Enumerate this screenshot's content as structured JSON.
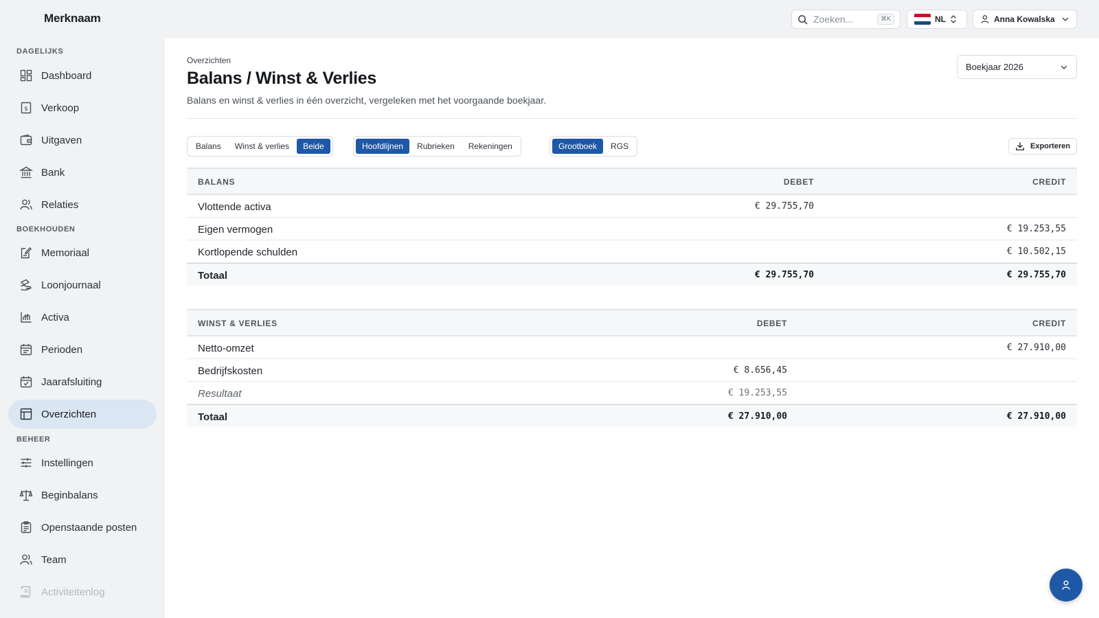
{
  "topbar": {
    "brand": "Merknaam",
    "search_placeholder": "Zoeken...",
    "search_shortcut": "⌘K",
    "language": "NL",
    "user_name": "Anna Kowalska"
  },
  "sidebar": {
    "sections": [
      "DAGELIJKS",
      "BOEKHOUDEN",
      "BEHEER"
    ],
    "items": [
      {
        "label": "Dashboard",
        "icon": "dashboard-icon"
      },
      {
        "label": "Verkoop",
        "icon": "invoice-icon"
      },
      {
        "label": "Uitgaven",
        "icon": "wallet-icon"
      },
      {
        "label": "Bank",
        "icon": "bank-icon"
      },
      {
        "label": "Relaties",
        "icon": "users-icon"
      },
      {
        "label": "Memoriaal",
        "icon": "edit-note-icon"
      },
      {
        "label": "Loonjournaal",
        "icon": "payroll-icon"
      },
      {
        "label": "Activa",
        "icon": "chart-icon"
      },
      {
        "label": "Perioden",
        "icon": "calendar-icon"
      },
      {
        "label": "Jaarafsluiting",
        "icon": "calendar-check-icon"
      },
      {
        "label": "Overzichten",
        "icon": "table-icon",
        "active": true
      },
      {
        "label": "Instellingen",
        "icon": "sliders-icon"
      },
      {
        "label": "Beginbalans",
        "icon": "scale-icon"
      },
      {
        "label": "Openstaande posten",
        "icon": "clipboard-icon"
      },
      {
        "label": "Team",
        "icon": "team-icon"
      },
      {
        "label": "Activiteitenlog",
        "icon": "log-icon"
      }
    ]
  },
  "page": {
    "breadcrumb": "Overzichten",
    "title": "Balans / Winst & Verlies",
    "subtitle": "Balans en winst & verlies in één overzicht, vergeleken met het voorgaande boekjaar.",
    "year_select": "Boekjaar 2026",
    "export_label": "Exporteren"
  },
  "filters": {
    "view": {
      "options": [
        "Balans",
        "Winst & verlies",
        "Beide"
      ],
      "selected": "Beide"
    },
    "level": {
      "options": [
        "Hoofdlijnen",
        "Rubrieken",
        "Rekeningen"
      ],
      "selected": "Hoofdlijnen"
    },
    "scheme": {
      "options": [
        "Grootboek",
        "RGS"
      ],
      "selected": "Grootboek"
    }
  },
  "balans": {
    "header": "BALANS",
    "debet_header": "DEBET",
    "credit_header": "CREDIT",
    "rows": [
      {
        "label": "Vlottende activa",
        "debet": "€ 29.755,70",
        "credit": ""
      },
      {
        "label": "Eigen vermogen",
        "debet": "",
        "credit": "€ 19.253,55"
      },
      {
        "label": "Kortlopende schulden",
        "debet": "",
        "credit": "€ 10.502,15"
      }
    ],
    "total": {
      "label": "Totaal",
      "debet": "€ 29.755,70",
      "credit": "€ 29.755,70"
    }
  },
  "wv": {
    "header": "WINST & VERLIES",
    "debet_header": "DEBET",
    "credit_header": "CREDIT",
    "rows": [
      {
        "label": "Netto-omzet",
        "debet": "",
        "credit": "€ 27.910,00"
      },
      {
        "label": "Bedrijfskosten",
        "debet": "€ 8.656,45",
        "credit": ""
      }
    ],
    "result": {
      "label": "Resultaat",
      "debet": "€ 19.253,55",
      "credit": ""
    },
    "total": {
      "label": "Totaal",
      "debet": "€ 27.910,00",
      "credit": "€ 27.910,00"
    }
  },
  "colors": {
    "accent": "#1f58a6",
    "active_nav": "#dbe6f3",
    "sidebar_bg": "#f1f2f4"
  }
}
